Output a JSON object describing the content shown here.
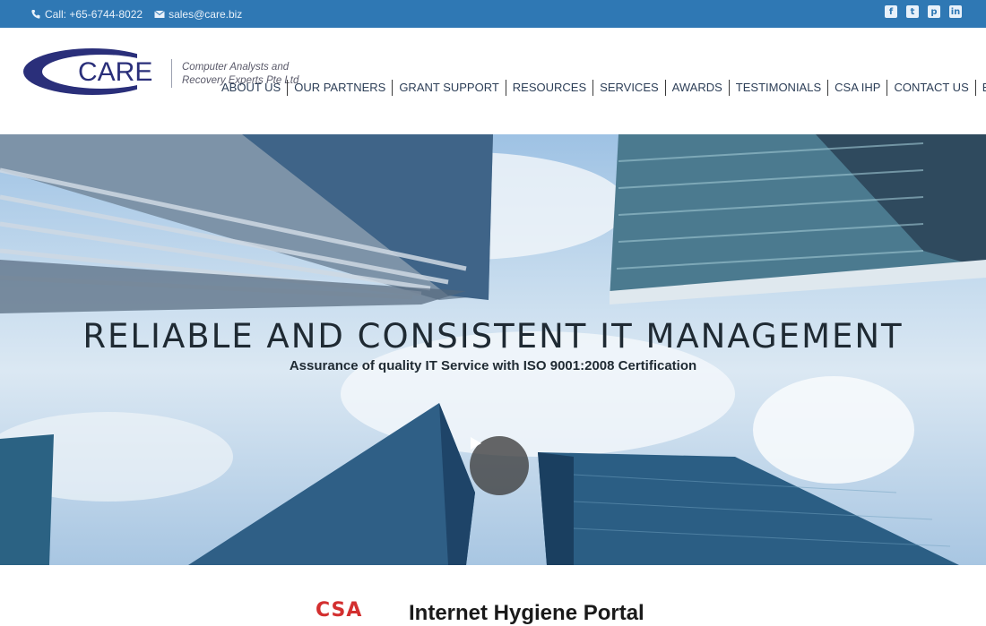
{
  "topbar": {
    "phone": "Call: +65-6744-8022",
    "email": "sales@care.biz",
    "social": [
      {
        "icon": "facebook-icon",
        "glyph": "f"
      },
      {
        "icon": "twitter-icon",
        "glyph": "t"
      },
      {
        "icon": "pinterest-icon",
        "glyph": "p"
      },
      {
        "icon": "linkedin-icon",
        "glyph": "in"
      }
    ]
  },
  "logo": {
    "brand": "CARE",
    "tagline_1": "Computer Analysts and",
    "tagline_2": "Recovery Experts Pte Ltd",
    "brand_color": "#2a2f7a"
  },
  "nav": {
    "items": [
      "ABOUT US",
      "OUR PARTNERS",
      "GRANT SUPPORT",
      "RESOURCES",
      "SERVICES",
      "AWARDS",
      "TESTIMONIALS",
      "CSA IHP",
      "CONTACT US",
      "BLOG"
    ]
  },
  "hero": {
    "headline": "RELIABLE AND CONSISTENT IT MANAGEMENT",
    "subline": "Assurance of quality IT Service with ISO 9001:2008 Certification",
    "play_icon": "play-icon"
  },
  "portal": {
    "logo_text": "CSA",
    "title": "Internet Hygiene Portal"
  },
  "colors": {
    "topbar": "#2f78b4",
    "nav_text": "#2c3e57",
    "csa_red": "#d32f2f"
  }
}
